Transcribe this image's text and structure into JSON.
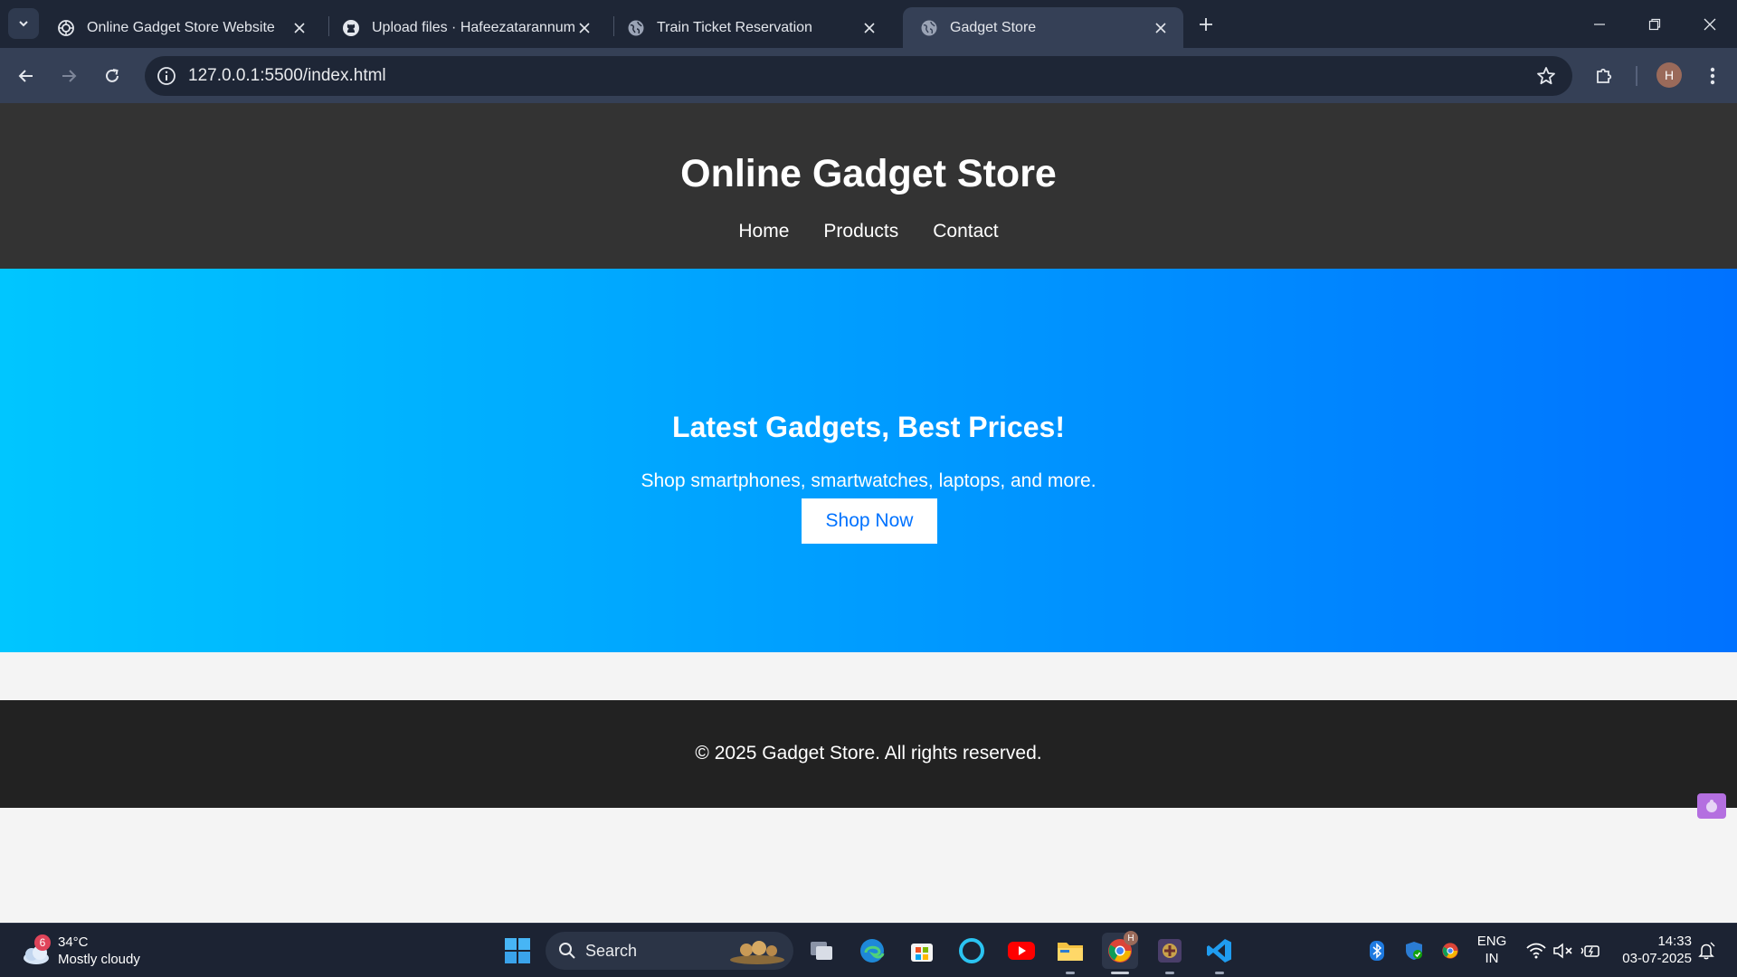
{
  "browser": {
    "tabs": [
      {
        "title": "Online Gadget Store Website",
        "favicon": "openai-icon"
      },
      {
        "title": "Upload files · Hafeezatarannum/CS",
        "favicon": "github-icon"
      },
      {
        "title": "Train Ticket Reservation",
        "favicon": "globe-icon"
      },
      {
        "title": "Gadget Store",
        "favicon": "globe-icon",
        "active": true
      }
    ],
    "url": "127.0.0.1:5500/index.html",
    "profile_initial": "H"
  },
  "site": {
    "title": "Online Gadget Store",
    "nav": [
      "Home",
      "Products",
      "Contact"
    ],
    "hero": {
      "heading": "Latest Gadgets, Best Prices!",
      "subtext": "Shop smartphones, smartwatches, laptops, and more.",
      "button": "Shop Now"
    },
    "footer": "© 2025 Gadget Store. All rights reserved.",
    "colors": {
      "header_bg": "#333333",
      "hero_gradient_start": "#00c6ff",
      "hero_gradient_end": "#0072ff",
      "footer_bg": "#222222"
    }
  },
  "taskbar": {
    "weather": {
      "temp": "34°C",
      "condition": "Mostly cloudy",
      "badge": "6"
    },
    "search_label": "Search",
    "chrome_badge": "H",
    "lang": {
      "line1": "ENG",
      "line2": "IN"
    },
    "time": "14:33",
    "date": "03-07-2025"
  }
}
